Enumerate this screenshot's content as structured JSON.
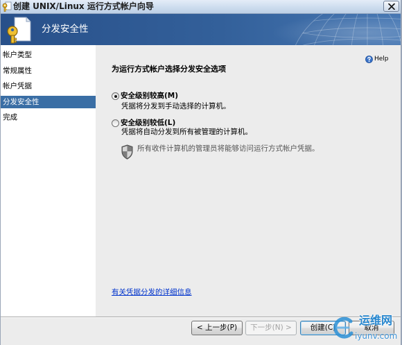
{
  "window": {
    "title": "创建 UNIX/Linux 运行方式帐户向导",
    "icon": "key-icon",
    "close_icon": "close-icon"
  },
  "header": {
    "title": "分发安全性",
    "icon": "key-document-icon",
    "background_color": "#33609a"
  },
  "nav": {
    "selected_color": "#3a6ea5",
    "items": [
      {
        "label": "帐户类型",
        "selected": false
      },
      {
        "label": "常规属性",
        "selected": false
      },
      {
        "label": "帐户凭据",
        "selected": false
      },
      {
        "label": "分发安全性",
        "selected": true
      },
      {
        "label": "完成",
        "selected": false
      }
    ]
  },
  "main": {
    "help": {
      "label": "Help",
      "icon": "help-icon"
    },
    "heading": "为运行方式帐户选择分发安全选项",
    "options": [
      {
        "label": "安全级别较高(M)",
        "description": "凭据将分发到手动选择的计算机。",
        "selected": true
      },
      {
        "label": "安全级别较低(L)",
        "description": "凭据将自动分发到所有被管理的计算机。",
        "selected": false
      }
    ],
    "notice": {
      "icon": "shield-icon",
      "text": "所有收件计算机的管理员将能够访问运行方式帐户凭据。"
    },
    "link": {
      "label": "有关凭据分发的详细信息",
      "color": "#0033cc"
    }
  },
  "footer": {
    "buttons": [
      {
        "label": "< 上一步(P)",
        "enabled": true,
        "default": false
      },
      {
        "label": "下一步(N) >",
        "enabled": false,
        "default": false
      },
      {
        "label": "创建(C)",
        "enabled": true,
        "default": true
      },
      {
        "label": "取消",
        "enabled": true,
        "default": false
      }
    ]
  },
  "watermark": {
    "name": "运维网",
    "site": "iyunv.com",
    "icon": "watermark-logo-icon"
  }
}
